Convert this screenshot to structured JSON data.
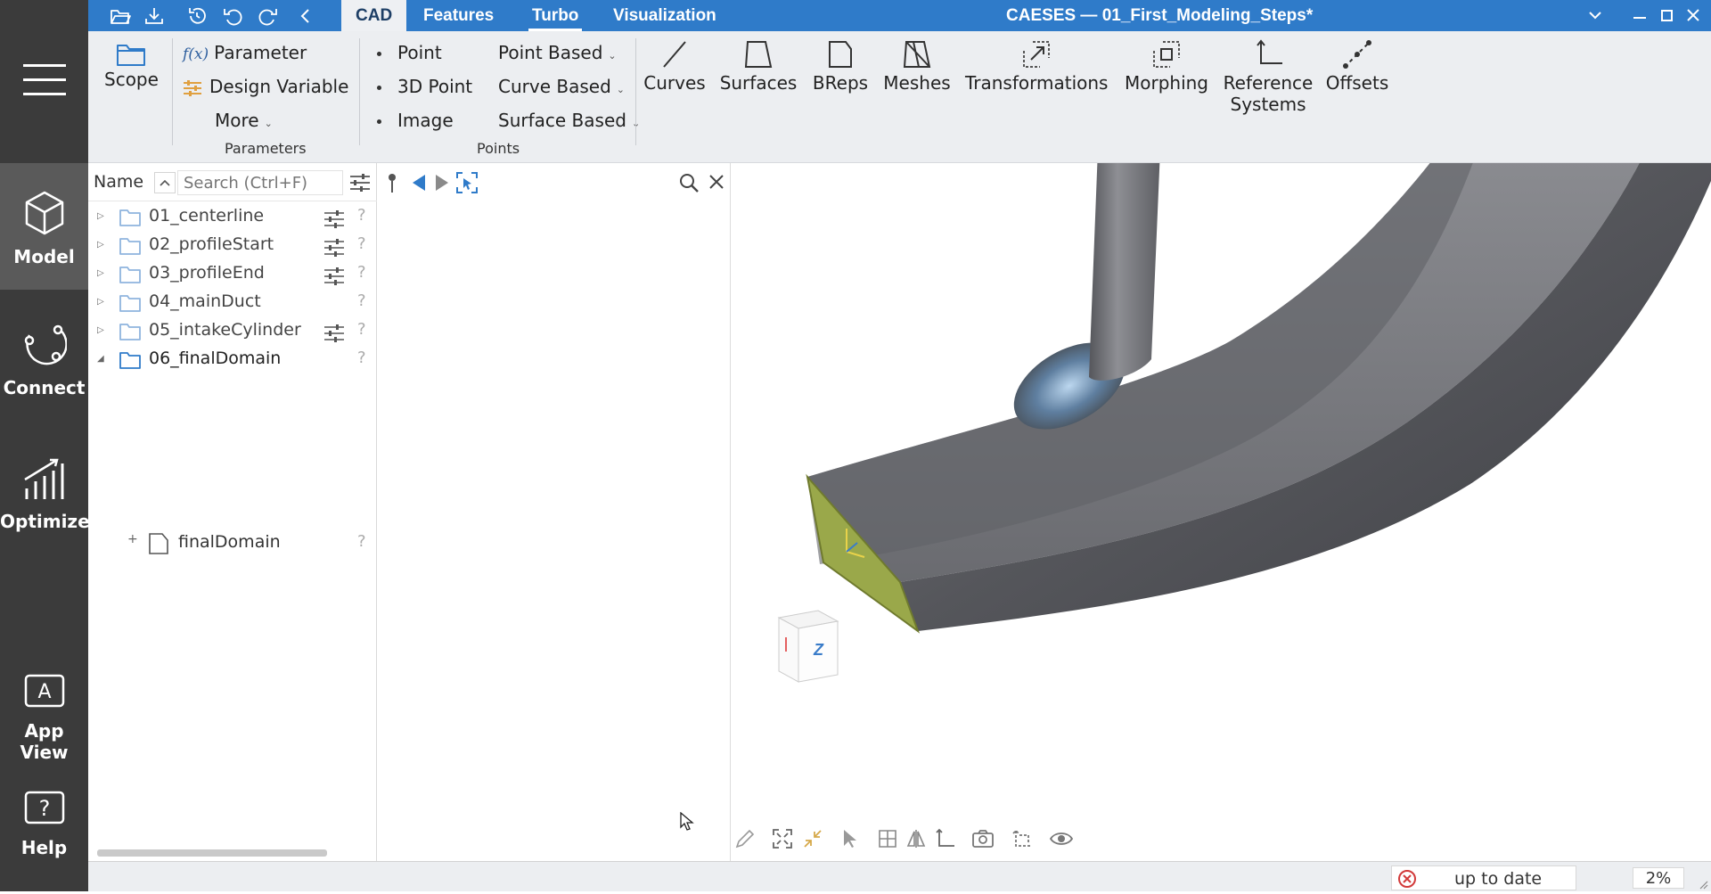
{
  "app": {
    "window_title": "CAESES — 01_First_Modeling_Steps*",
    "tabs": [
      {
        "label": "CAD",
        "active": true
      },
      {
        "label": "Features",
        "active": false
      },
      {
        "label": "Turbo",
        "active": false
      },
      {
        "label": "Visualization",
        "active": false
      }
    ],
    "accent_color": "#2f7bc9"
  },
  "leftnav": {
    "items": [
      {
        "label": "Model",
        "active": true
      },
      {
        "label": "Connect",
        "active": false
      },
      {
        "label": "Optimize",
        "active": false
      },
      {
        "label": "App View",
        "active": false
      },
      {
        "label": "Help",
        "active": false
      }
    ]
  },
  "ribbon": {
    "scope_label": "Scope",
    "parameter_label": "Parameter",
    "parameter_prefix": "f(x)",
    "design_variable_label": "Design Variable",
    "more_label": "More",
    "parameters_group": "Parameters",
    "point_label": "Point",
    "point3d_label": "3D Point",
    "image_label": "Image",
    "point_based_label": "Point Based",
    "curve_based_label": "Curve Based",
    "surface_based_label": "Surface Based",
    "points_group": "Points",
    "curves_label": "Curves",
    "surfaces_label": "Surfaces",
    "breps_label": "BReps",
    "meshes_label": "Meshes",
    "transformations_label": "Transformations",
    "morphing_label": "Morphing",
    "reference_systems_line1": "Reference",
    "reference_systems_line2": "Systems",
    "offsets_label": "Offsets"
  },
  "tree": {
    "column_header": "Name",
    "search_placeholder": "Search (Ctrl+F)",
    "rows": [
      {
        "label": "01_centerline",
        "expanded": false,
        "has_params": true
      },
      {
        "label": "02_profileStart",
        "expanded": false,
        "has_params": true
      },
      {
        "label": "03_profileEnd",
        "expanded": false,
        "has_params": true
      },
      {
        "label": "04_mainDuct",
        "expanded": false,
        "has_params": false
      },
      {
        "label": "05_intakeCylinder",
        "expanded": false,
        "has_params": true
      },
      {
        "label": "06_finalDomain",
        "expanded": true,
        "has_params": false
      }
    ],
    "child_row": {
      "label": "finalDomain"
    },
    "help_glyph": "?"
  },
  "viewcube": {
    "face_label": "Z"
  },
  "status": {
    "state_text": "up to date",
    "percent_text": "2%"
  }
}
